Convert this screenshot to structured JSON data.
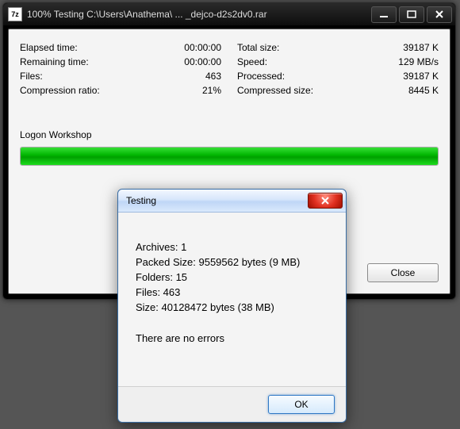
{
  "window": {
    "app_icon_text": "7z",
    "title": "100% Testing C:\\Users\\Anathema\\ ... _dejco-d2s2dv0.rar"
  },
  "stats_left": [
    {
      "label": "Elapsed time:",
      "value": "00:00:00"
    },
    {
      "label": "Remaining time:",
      "value": "00:00:00"
    },
    {
      "label": "Files:",
      "value": "463"
    },
    {
      "label": "Compression ratio:",
      "value": "21%"
    }
  ],
  "stats_right": [
    {
      "label": "Total size:",
      "value": "39187 K"
    },
    {
      "label": "Speed:",
      "value": "129 MB/s"
    },
    {
      "label": "Processed:",
      "value": "39187 K"
    },
    {
      "label": "Compressed size:",
      "value": "8445 K"
    }
  ],
  "current_file": "Logon Workshop",
  "buttons": {
    "close": "Close"
  },
  "modal": {
    "title": "Testing",
    "lines": [
      "Archives: 1",
      "Packed Size: 9559562 bytes (9 MB)",
      "Folders: 15",
      "Files: 463",
      "Size: 40128472 bytes (38 MB)"
    ],
    "result": "There are no errors",
    "ok": "OK"
  }
}
